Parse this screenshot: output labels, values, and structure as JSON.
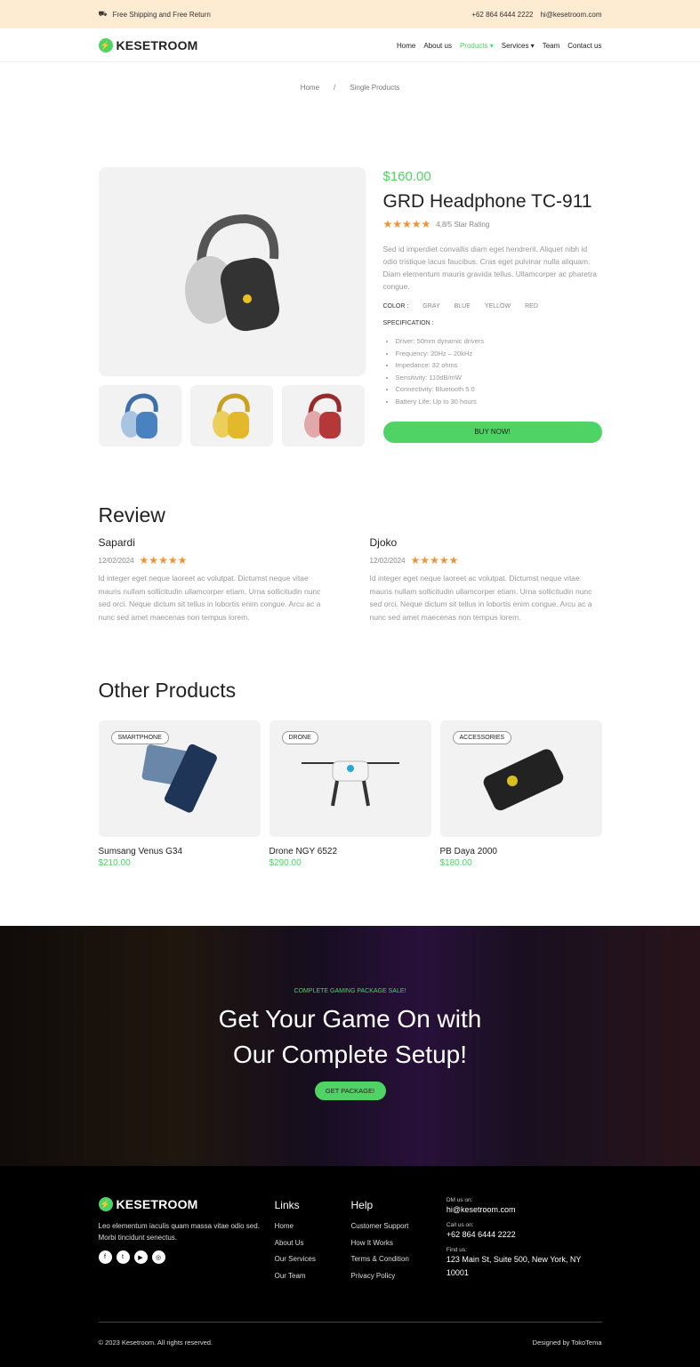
{
  "topbar": {
    "shipping": "Free Shipping and Free Return",
    "phone": "+62 864 6444 2222",
    "email": "hi@kesetroom.com"
  },
  "brand": {
    "name": "KESETROOM",
    "accent": "#4fd364"
  },
  "nav": [
    {
      "label": "Home"
    },
    {
      "label": "About us"
    },
    {
      "label": "Products ▾",
      "active": true
    },
    {
      "label": "Services ▾"
    },
    {
      "label": "Team"
    },
    {
      "label": "Contact us"
    }
  ],
  "breadcrumb": {
    "home": "Home",
    "sep": "/",
    "current": "Single Products"
  },
  "product": {
    "price": "$160.00",
    "title": "GRD Headphone TC-911",
    "stars": "★★★★★",
    "rating": "4,8/5 Star Rating",
    "description": "Sed id imperdiet convallis diam eget hendrerit. Aliquet nibh id odio tristique lacus faucibus. Cras eget pulvinar nulla aliquam. Diam elementum mauris gravida tellus. Ullamcorper ac pharetra congue.",
    "color_label": "COLOR :",
    "colors": [
      "GRAY",
      "BLUE",
      "YELLOW",
      "RED"
    ],
    "spec_label": "SPECIFICATION :",
    "specs": [
      "Driver: 50mm dynamic drivers",
      "Frequency: 20Hz – 20kHz",
      "Impedance: 32 ohms",
      "Sensitivity: 110dB/mW",
      "Connectivity: Bluetooth 5.0",
      "Battery Life: Up to 30 hours"
    ],
    "buy_label": "BUY NOW!"
  },
  "review": {
    "heading": "Review",
    "items": [
      {
        "name": "Sapardi",
        "date": "12/02/2024",
        "stars": "★★★★★",
        "text": "Id integer eget neque laoreet ac volutpat. Dictumst neque vitae mauris nullam sollicitudin ullamcorper etiam. Urna sollicitudin nunc sed orci. Neque dictum sit tellus in lobortis enim congue. Arcu ac a nunc sed amet maecenas non tempus lorem."
      },
      {
        "name": "Djoko",
        "date": "12/02/2024",
        "stars": "★★★★★",
        "text": "Id integer eget neque laoreet ac volutpat. Dictumst neque vitae mauris nullam sollicitudin ullamcorper etiam. Urna sollicitudin nunc sed orci. Neque dictum sit tellus in lobortis enim congue. Arcu ac a nunc sed amet maecenas non tempus lorem."
      }
    ]
  },
  "others": {
    "heading": "Other Products",
    "items": [
      {
        "badge": "SMARTPHONE",
        "name": "Sumsang Venus G34",
        "price": "$210.00"
      },
      {
        "badge": "DRONE",
        "name": "Drone NGY 6522",
        "price": "$290.00"
      },
      {
        "badge": "ACCESSORIES",
        "name": "PB Daya 2000",
        "price": "$180.00"
      }
    ]
  },
  "hero": {
    "kicker": "COMPLETE GAMING PACKAGE SALE!",
    "line1": "Get Your Game On with",
    "line2": "Our Complete Setup!",
    "cta": "GET PACKAGE!"
  },
  "footer": {
    "about": "Leo elementum iaculis quam massa vitae odio sed. Morbi tincidunt senectus.",
    "links_title": "Links",
    "links": [
      "Home",
      "About Us",
      "Our Services",
      "Our Team"
    ],
    "help_title": "Help",
    "help": [
      "Customer Support",
      "How It Works",
      "Terms & Condition",
      "Privacy Policy"
    ],
    "dm_label": "DM us on:",
    "dm": "hi@kesetroom.com",
    "call_label": "Call us on:",
    "call": "+62 864 6444 2222",
    "find_label": "Find us:",
    "find": "123 Main St, Suite 500, New York, NY 10001",
    "copyright": "© 2023 Kesetroom. All rights reserved.",
    "designed": "Designed by TokoTema"
  }
}
